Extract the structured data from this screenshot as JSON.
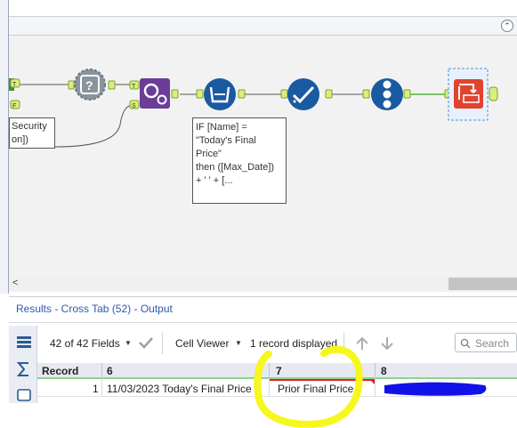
{
  "canvas": {
    "collapse_icon": "⌃",
    "annotations": [
      {
        "text": "Security\non])"
      },
      {
        "text": "IF [Name] =\n\"Today's Final\nPrice\"\nthen ([Max_Date])\n+ ' ' + [..."
      }
    ],
    "anchor_labels": {
      "t": "T",
      "f": "F",
      "s": "S"
    },
    "tools": [
      {
        "name": "filter-question-tool",
        "color": "#6b7780"
      },
      {
        "name": "formula-tool",
        "color": "#6b3d96"
      },
      {
        "name": "summarize-tool",
        "color": "#1a5aa0"
      },
      {
        "name": "select-tool",
        "color": "#1a5aa0"
      },
      {
        "name": "record-id-tool",
        "color": "#1a5aa0"
      },
      {
        "name": "cross-tab-tool",
        "color": "#e0442f"
      }
    ],
    "connector_color": "#53b53b"
  },
  "scrollbar": {
    "left_arrow": "<"
  },
  "results": {
    "title": "Results - Cross Tab (52) - Output",
    "toolbar": {
      "fields": "42 of 42 Fields",
      "viewer": "Cell Viewer",
      "records": "1 record displayed",
      "search_placeholder": "Search"
    },
    "columns": [
      "Record",
      "6",
      "7",
      "8"
    ],
    "rows": [
      {
        "record": "1",
        "c6": "11/03/2023 Today's Final Price",
        "c7": "Prior Final Price",
        "c8": ""
      }
    ]
  },
  "colors": {
    "link_blue": "#2e5aa8",
    "highlight_yellow": "#f6f71c",
    "redaction_blue": "#1212e8",
    "header_underline": "#8fd18f",
    "error_red": "#e02020"
  }
}
